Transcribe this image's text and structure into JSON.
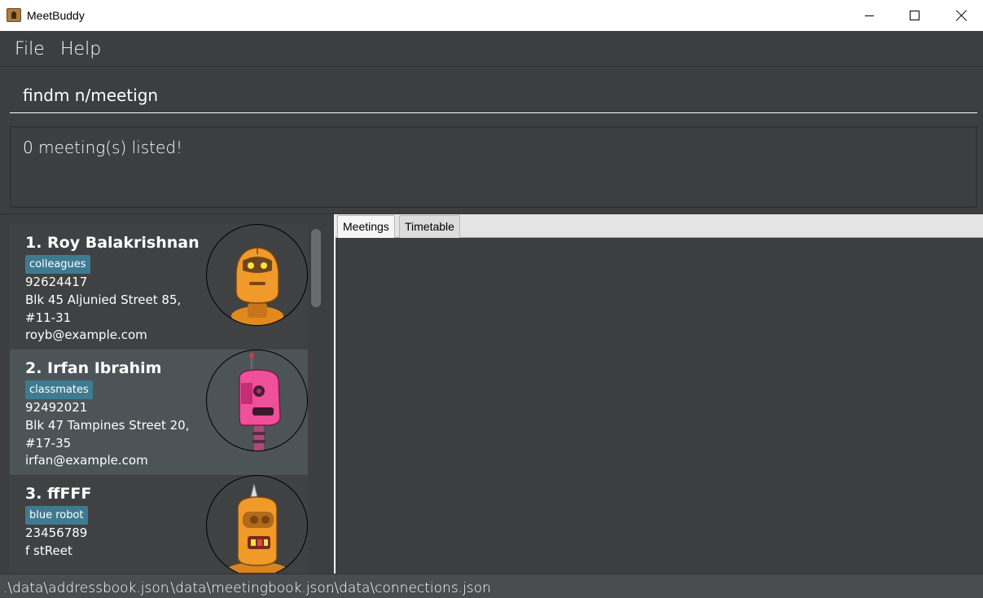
{
  "window": {
    "title": "MeetBuddy"
  },
  "menu": {
    "file": "File",
    "help": "Help"
  },
  "command": {
    "value": "findm n/meetign"
  },
  "result": {
    "message": "0 meeting(s) listed!"
  },
  "persons": [
    {
      "index_name": "1.  Roy Balakrishnan",
      "tag": "colleagues",
      "phone": "92624417",
      "address_line1": "Blk 45 Aljunied Street 85,",
      "address_line2": "#11-31",
      "email": "royb@example.com",
      "avatar_icon": "orange-robot-icon"
    },
    {
      "index_name": "2.  Irfan Ibrahim",
      "tag": "classmates",
      "phone": "92492021",
      "address_line1": "Blk 47 Tampines Street 20,",
      "address_line2": "#17-35",
      "email": "irfan@example.com",
      "avatar_icon": "pink-robot-icon"
    },
    {
      "index_name": "3.  ffFFF",
      "tag": "blue robot",
      "phone": "23456789",
      "address_line1": "f stReet",
      "avatar_icon": "orange-horned-robot-icon"
    }
  ],
  "tabs": {
    "meetings": "Meetings",
    "timetable": "Timetable"
  },
  "status": {
    "addressbook": ".\\data\\addressbook.json",
    "meetingbook": ".\\data\\meetingbook.json",
    "connections": ".\\data\\connections.json"
  },
  "colors": {
    "background": "#3c3e3f",
    "selected_card": "#4c5457",
    "tag": "#3e7b91"
  }
}
